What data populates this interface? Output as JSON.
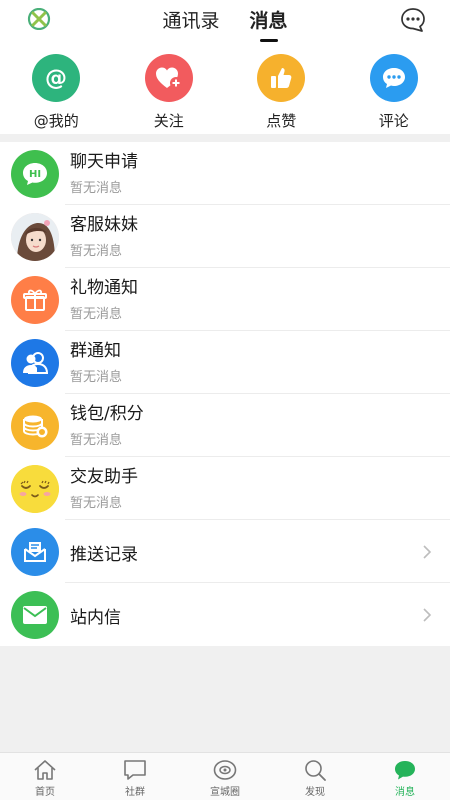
{
  "header": {
    "tabs": [
      "通讯录",
      "消息"
    ],
    "active_tab": 1
  },
  "quick_actions": [
    {
      "label": "@我的",
      "icon": "at-icon",
      "color": "#2db47d"
    },
    {
      "label": "关注",
      "icon": "heart-plus-icon",
      "color": "#f25b5e"
    },
    {
      "label": "点赞",
      "icon": "thumbs-up-icon",
      "color": "#f6b12d"
    },
    {
      "label": "评论",
      "icon": "comment-icon",
      "color": "#2b9cf0"
    }
  ],
  "messages": [
    {
      "title": "聊天申请",
      "sub": "暂无消息",
      "icon": "hi-chat-icon",
      "color": "#3fbf4e"
    },
    {
      "title": "客服妹妹",
      "sub": "暂无消息",
      "icon": "girl-avatar-icon",
      "color": "#f4d6cc"
    },
    {
      "title": "礼物通知",
      "sub": "暂无消息",
      "icon": "gift-icon",
      "color": "#ff7e47"
    },
    {
      "title": "群通知",
      "sub": "暂无消息",
      "icon": "group-icon",
      "color": "#1e78e6"
    },
    {
      "title": "钱包/积分",
      "sub": "暂无消息",
      "icon": "coins-icon",
      "color": "#f7b52c"
    },
    {
      "title": "交友助手",
      "sub": "暂无消息",
      "icon": "smiley-icon",
      "color": "#f8dc3c"
    }
  ],
  "links": [
    {
      "title": "推送记录",
      "icon": "envelope-open-icon",
      "color": "#2b8de8"
    },
    {
      "title": "站内信",
      "icon": "envelope-icon",
      "color": "#3cbf55"
    }
  ],
  "tabbar": {
    "items": [
      {
        "label": "首页",
        "icon": "home-icon"
      },
      {
        "label": "社群",
        "icon": "chat-bubble-icon"
      },
      {
        "label": "宣城圈",
        "icon": "circle-eye-icon"
      },
      {
        "label": "发现",
        "icon": "search-icon"
      },
      {
        "label": "消息",
        "icon": "message-icon"
      }
    ],
    "active": 4,
    "active_color": "#25b35a"
  }
}
